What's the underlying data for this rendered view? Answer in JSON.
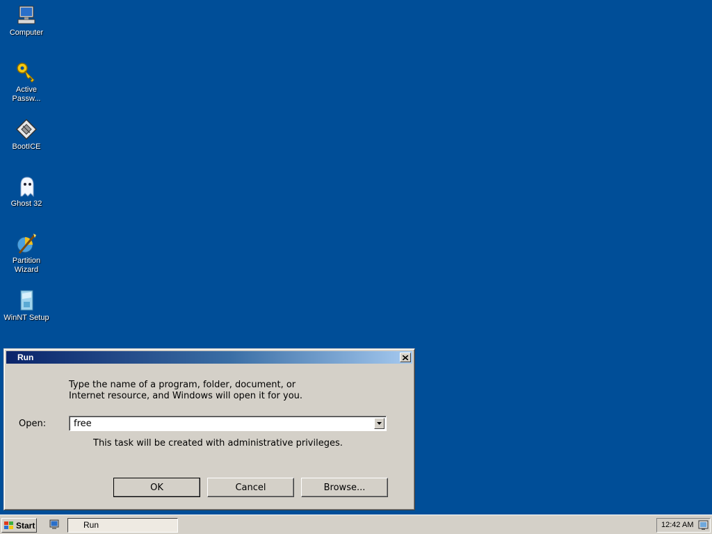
{
  "desktop": {
    "icons": [
      {
        "label": "Computer",
        "icon": "computer-icon"
      },
      {
        "label": "Active Passw...",
        "icon": "key-icon"
      },
      {
        "label": "BootICE",
        "icon": "bootice-icon"
      },
      {
        "label": "Ghost 32",
        "icon": "ghost-icon"
      },
      {
        "label": "Partition Wizard",
        "icon": "partition-wizard-icon"
      },
      {
        "label": "WinNT Setup",
        "icon": "winnt-setup-icon"
      }
    ]
  },
  "run_dialog": {
    "title": "Run",
    "instruction_line1": "Type the name of a program, folder, document, or",
    "instruction_line2": "Internet resource, and Windows will open it for you.",
    "open_label": "Open:",
    "open_value": "free",
    "admin_note": "This task will be created with administrative privileges.",
    "ok_label": "OK",
    "cancel_label": "Cancel",
    "browse_label": "Browse..."
  },
  "taskbar": {
    "start_label": "Start",
    "task_label": "Run",
    "clock": "12:42 AM"
  },
  "colors": {
    "desktop_bg": "#004e98",
    "title_gradient_start": "#0a246a",
    "title_gradient_end": "#a6caf0",
    "chrome": "#d4d0c8"
  }
}
